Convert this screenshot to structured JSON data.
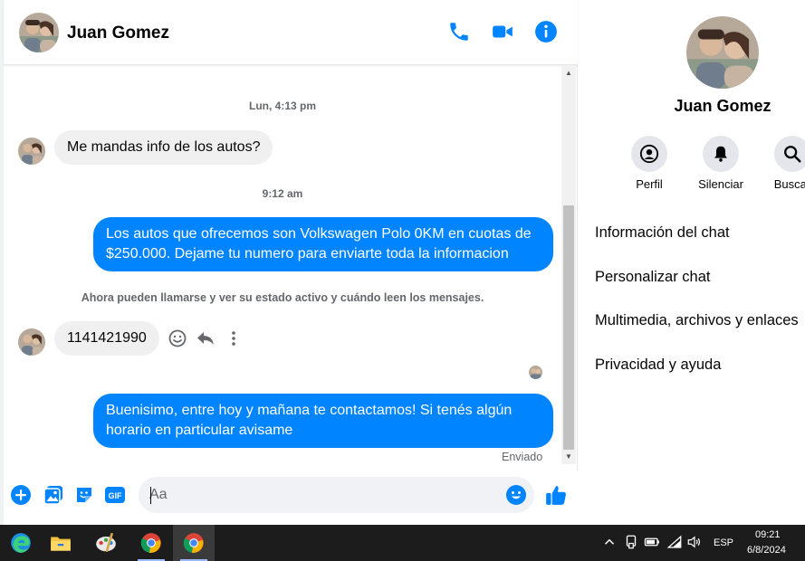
{
  "contact": {
    "name": "Juan Gomez"
  },
  "header_icons": [
    "phone-icon",
    "video-camera-icon",
    "info-icon"
  ],
  "messages": {
    "timestamp_1": "Lun, 4:13 pm",
    "incoming_1": "Me mandas info de los autos?",
    "timestamp_2": "9:12 am",
    "outgoing_1_line1": "Los autos que ofrecemos son Volkswagen Polo 0KM en cuotas de",
    "outgoing_1_line2": "$250.000.  Dejame tu numero para enviarte toda la informacion",
    "system_note": "Ahora pueden llamarse y ver su estado activo y cuándo leen los mensajes.",
    "incoming_2": "1141421990",
    "outgoing_2_line1": "Buenisimo, entre hoy y mañana te contactamos! Si tenés algún",
    "outgoing_2_line2": "horario en particular avisame",
    "sent_status": "Enviado"
  },
  "composer": {
    "placeholder": "Aa",
    "gif_label": "GIF"
  },
  "side_panel": {
    "name": "Juan Gomez",
    "buttons": [
      {
        "label": "Perfil",
        "icon": "profile-icon"
      },
      {
        "label": "Silenciar",
        "icon": "bell-icon"
      },
      {
        "label": "Buscar",
        "icon": "search-icon"
      }
    ],
    "items": [
      "Información del chat",
      "Personalizar chat",
      "Multimedia, archivos y enlaces",
      "Privacidad y ayuda"
    ]
  },
  "taskbar": {
    "language": "ESP",
    "time": "09:21",
    "date": "6/8/2024"
  },
  "colors": {
    "accent": "#0084ff",
    "incoming_bubble": "#f0f0f0",
    "taskbar": "#1c1c1c"
  }
}
